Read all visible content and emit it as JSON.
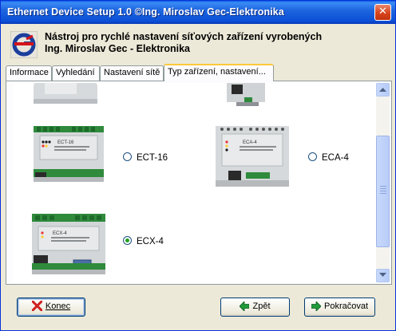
{
  "window": {
    "title": "Ethernet Device Setup  1.0 ©Ing. Miroslav Gec-Elektronika",
    "close_glyph": "✕"
  },
  "header": {
    "logo_icon": "gec-logo-icon",
    "line1": "Nástroj pro rychlé nastavení síťových zařízení vyrobených",
    "line2": "Ing. Miroslav Gec - Elektronika"
  },
  "tabs": [
    {
      "label": "Informace",
      "active": false
    },
    {
      "label": "Vyhledání",
      "active": false
    },
    {
      "label": "Nastavení sítě",
      "active": false
    },
    {
      "label": "Typ zařízení, nastavení...",
      "active": true
    }
  ],
  "devices": [
    {
      "label": "ECT-16",
      "selected": false,
      "image_label": "ECT-16"
    },
    {
      "label": "ECA-4",
      "selected": false,
      "image_label": "ECA-4"
    },
    {
      "label": "ECX-4",
      "selected": true,
      "image_label": "ECX-4"
    }
  ],
  "buttons": {
    "exit": "Konec",
    "back": "Zpět",
    "next": "Pokračovat"
  },
  "colors": {
    "title_bar": "#0a4fd6",
    "tab_highlight": "#ffc83c",
    "radio_checked": "#21a121",
    "exit_icon": "#d02020",
    "nav_icon": "#1f9b3a"
  }
}
